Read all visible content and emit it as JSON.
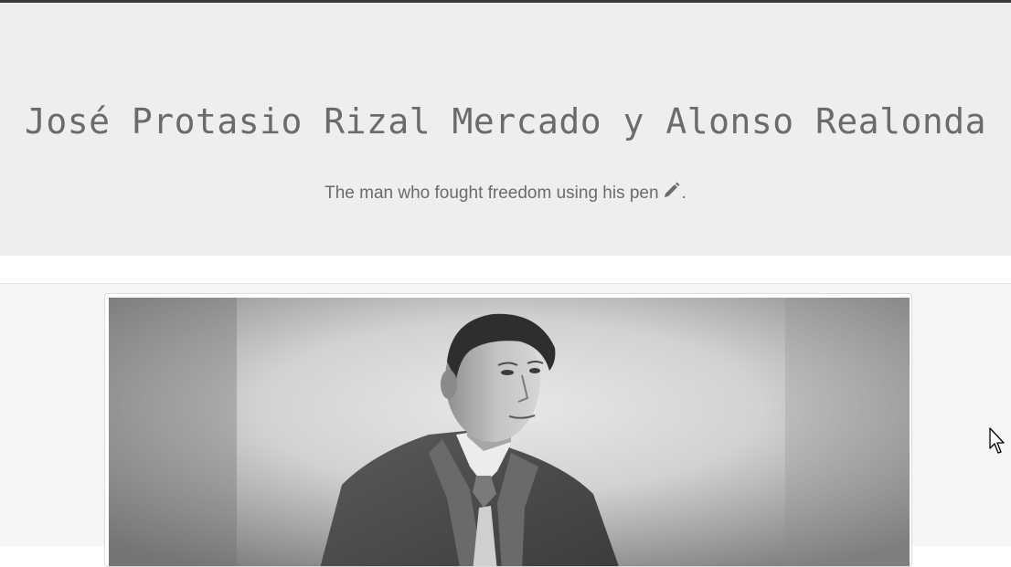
{
  "header": {
    "title": "José Protasio Rizal Mercado y Alonso Realonda",
    "subtitle": "The man who fought freedom using his pen",
    "subtitle_icon": "pencil-icon",
    "subtitle_end": "."
  },
  "main": {
    "image": {
      "subject": "black-and-white portrait photograph",
      "palette": "grayscale"
    }
  },
  "colors": {
    "hero_background": "#eeeeee",
    "content_background": "#f5f5f5",
    "text": "#6b6b6b"
  }
}
